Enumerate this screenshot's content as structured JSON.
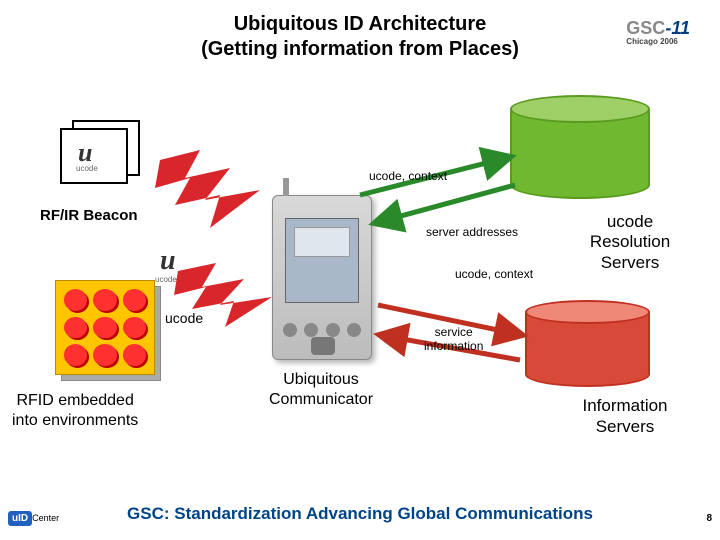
{
  "title_line1": "Ubiquitous ID Architecture",
  "title_line2": "(Getting information from Places)",
  "logo": {
    "prefix": "GSC",
    "dash": "-",
    "num": "11",
    "sub": "Chicago 2006"
  },
  "beacon": {
    "u": "u",
    "sub": "ucode",
    "label": "RF/IR Beacon"
  },
  "rfid": {
    "u": "u",
    "sub": "ucode",
    "small_label": "ucode",
    "label_line1": "RFID embedded",
    "label_line2": "into environments"
  },
  "device": {
    "label_line1": "Ubiquitous",
    "label_line2": "Communicator"
  },
  "db_green": {
    "label_line1": "ucode",
    "label_line2": "Resolution",
    "label_line3": "Servers"
  },
  "db_red": {
    "label_line1": "Information",
    "label_line2": "Servers"
  },
  "flows": {
    "ucode_context_up": "ucode, context",
    "server_addresses": "server addresses",
    "ucode_context_mid": "ucode, context",
    "service_info_line1": "service",
    "service_info_line2": "information"
  },
  "footer": {
    "badge": "uID",
    "center_text": "Center",
    "tagline": "GSC: Standardization Advancing Global Communications"
  },
  "page": "8"
}
